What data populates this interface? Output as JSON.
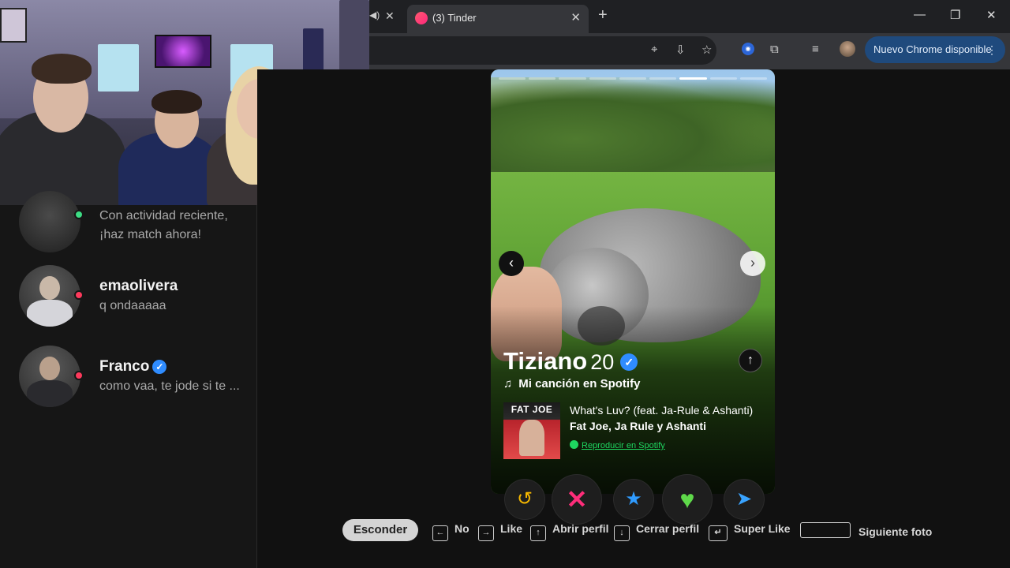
{
  "browser": {
    "tab_title": "(3) Tinder",
    "new_tab_icon": "+",
    "update_label": "Nuevo Chrome disponible",
    "more_icon": "⋮"
  },
  "sidebar": {
    "matches": [
      {
        "name": "",
        "message_line1": "Con actividad reciente,",
        "message_line2": "¡haz match ahora!",
        "status_color": "#3ddc84"
      },
      {
        "name": "emaolivera",
        "message": "q ondaaaaa",
        "status_color": "#fd3a5c"
      },
      {
        "name": "Franco",
        "message": "como vaa, te jode si te ...",
        "verified": true,
        "status_color": "#fd3a5c"
      }
    ]
  },
  "profile": {
    "name": "Tiziano",
    "age": "20",
    "verified": true,
    "photo_count": 9,
    "current_photo": 7,
    "spotify_heading": "Mi canción en Spotify",
    "album_text": "FAT JOE",
    "song_title": "What's Luv? (feat. Ja-Rule & Ashanti)",
    "song_artist": "Fat Joe, Ja Rule y Ashanti",
    "play_link": "Reproducir en Spotify"
  },
  "actions": {
    "rewind_icon": "↺",
    "nope_icon": "✕",
    "superlike_icon": "★",
    "like_icon": "♥",
    "boost_icon": "➤"
  },
  "shortcuts": {
    "hide_label": "Esconder",
    "items": [
      {
        "key": "←",
        "label": "No"
      },
      {
        "key": "→",
        "label": "Like"
      },
      {
        "key": "↑",
        "label": "Abrir perfil"
      },
      {
        "key": "↓",
        "label": "Cerrar perfil"
      },
      {
        "key": "↵",
        "label": "Super Like"
      },
      {
        "key": "",
        "label": "Siguiente foto"
      }
    ]
  },
  "colors": {
    "accent_pink": "#fd267d",
    "verified_blue": "#2f8cff",
    "spotify_green": "#1ed760",
    "update_button": "#1f4a7d"
  }
}
